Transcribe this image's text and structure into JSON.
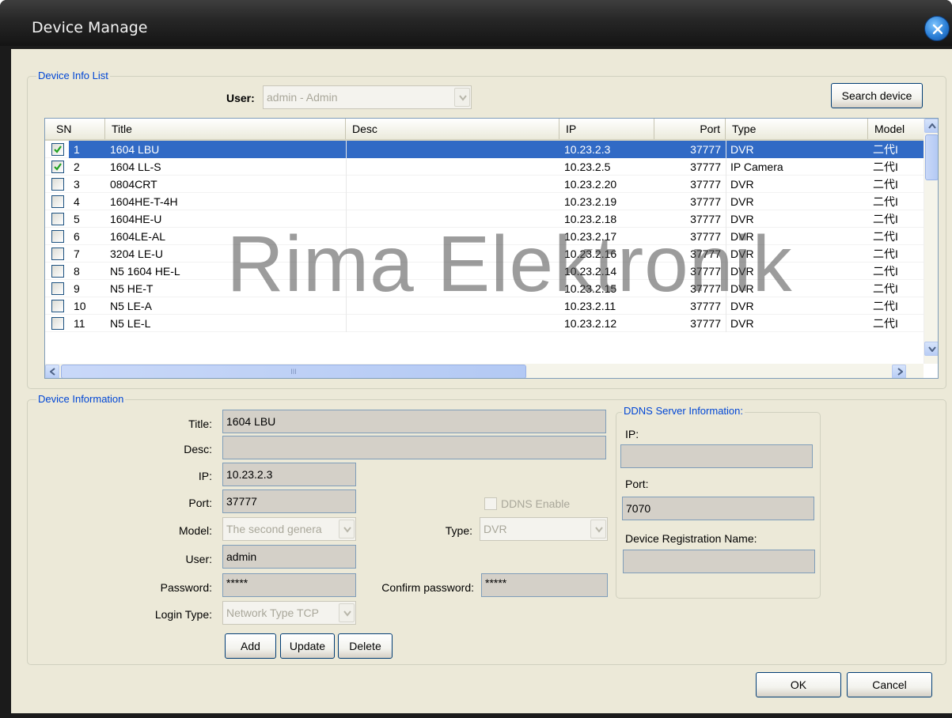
{
  "window": {
    "title": "Device Manage",
    "close_icon": "close-icon"
  },
  "device_info_list": {
    "legend": "Device Info List",
    "user_label": "User:",
    "user_value": "admin - Admin",
    "search_button": "Search device",
    "columns": [
      "SN",
      "Title",
      "Desc",
      "IP",
      "Port",
      "Type",
      "Model"
    ],
    "rows": [
      {
        "checked": true,
        "sn": "1",
        "title": "1604 LBU",
        "desc": "",
        "ip": "10.23.2.3",
        "port": "37777",
        "type": "DVR",
        "model": "二代I"
      },
      {
        "checked": true,
        "sn": "2",
        "title": "1604 LL-S",
        "desc": "",
        "ip": "10.23.2.5",
        "port": "37777",
        "type": "IP Camera",
        "model": "二代I"
      },
      {
        "checked": false,
        "sn": "3",
        "title": "0804CRT",
        "desc": "",
        "ip": "10.23.2.20",
        "port": "37777",
        "type": "DVR",
        "model": "二代I"
      },
      {
        "checked": false,
        "sn": "4",
        "title": "1604HE-T-4H",
        "desc": "",
        "ip": "10.23.2.19",
        "port": "37777",
        "type": "DVR",
        "model": "二代I"
      },
      {
        "checked": false,
        "sn": "5",
        "title": "1604HE-U",
        "desc": "",
        "ip": "10.23.2.18",
        "port": "37777",
        "type": "DVR",
        "model": "二代I"
      },
      {
        "checked": false,
        "sn": "6",
        "title": "1604LE-AL",
        "desc": "",
        "ip": "10.23.2.17",
        "port": "37777",
        "type": "DVR",
        "model": "二代I"
      },
      {
        "checked": false,
        "sn": "7",
        "title": "3204 LE-U",
        "desc": "",
        "ip": "10.23.2.16",
        "port": "37777",
        "type": "DVR",
        "model": "二代I"
      },
      {
        "checked": false,
        "sn": "8",
        "title": "N5 1604 HE-L",
        "desc": "",
        "ip": "10.23.2.14",
        "port": "37777",
        "type": "DVR",
        "model": "二代I"
      },
      {
        "checked": false,
        "sn": "9",
        "title": "N5 HE-T",
        "desc": "",
        "ip": "10.23.2.15",
        "port": "37777",
        "type": "DVR",
        "model": "二代I"
      },
      {
        "checked": false,
        "sn": "10",
        "title": "N5 LE-A",
        "desc": "",
        "ip": "10.23.2.11",
        "port": "37777",
        "type": "DVR",
        "model": "二代I"
      },
      {
        "checked": false,
        "sn": "11",
        "title": "N5 LE-L",
        "desc": "",
        "ip": "10.23.2.12",
        "port": "37777",
        "type": "DVR",
        "model": "二代I"
      }
    ],
    "scroll_grip": "III"
  },
  "device_information": {
    "legend": "Device Information",
    "title_label": "Title:",
    "title_value": "1604 LBU",
    "desc_label": "Desc:",
    "desc_value": "",
    "ip_label": "IP:",
    "ip_value": "10.23.2.3",
    "port_label": "Port:",
    "port_value": "37777",
    "ddns_enable_label": "DDNS Enable",
    "model_label": "Model:",
    "model_value": "The second genera",
    "type_label": "Type:",
    "type_value": "DVR",
    "user_label": "User:",
    "user_value": "admin",
    "password_label": "Password:",
    "password_value": "*****",
    "confirm_password_label": "Confirm password:",
    "confirm_password_value": "*****",
    "login_type_label": "Login Type:",
    "login_type_value": "Network Type TCP",
    "add_button": "Add",
    "update_button": "Update",
    "delete_button": "Delete"
  },
  "ddns": {
    "legend": "DDNS Server Information:",
    "ip_label": "IP:",
    "ip_value": "",
    "port_label": "Port:",
    "port_value": "7070",
    "reg_name_label": "Device Registration Name:",
    "reg_name_value": ""
  },
  "footer": {
    "ok_button": "OK",
    "cancel_button": "Cancel"
  },
  "watermark": "Rima Elektronik",
  "colors": {
    "selection": "#316ac5",
    "legend_text": "#0046d5",
    "dialog_bg": "#ece9d8",
    "titlebar": "#262626"
  }
}
